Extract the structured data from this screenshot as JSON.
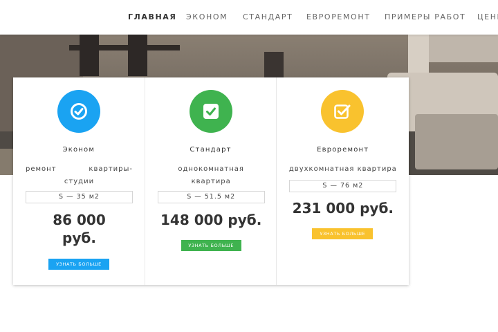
{
  "nav": {
    "items": [
      {
        "label": "ГЛАВНАЯ",
        "active": true
      },
      {
        "label": "ЭКОНОМ",
        "active": false
      },
      {
        "label": "СТАНДАРТ",
        "active": false
      },
      {
        "label": "ЕВРОРЕМОНТ",
        "active": false
      },
      {
        "label": "ПРИМЕРЫ РАБОТ",
        "active": false
      },
      {
        "label": "ЦЕНЫ",
        "active": false
      }
    ]
  },
  "cards": [
    {
      "title": "Эконом",
      "description": "ремонт квартиры-студии",
      "area": "S — 35 м2",
      "price": "86 000 руб.",
      "button": "УЗНАТЬ БОЛЬШЕ",
      "icon": "check-circle-icon",
      "color": "#1aa3f2",
      "button_color": "#1aa3f2"
    },
    {
      "title": "Стандарт",
      "description": "однокомнатная квартира",
      "area": "S — 51.5 м2",
      "price": "148 000 руб.",
      "button": "УЗНАТЬ БОЛЬШЕ",
      "icon": "check-square-icon",
      "color": "#3fb34f",
      "button_color": "#3fb34f"
    },
    {
      "title": "Евроремонт",
      "description": "двухкомнатная квартира",
      "area": "S — 76 м2",
      "price": "231 000 руб.",
      "button": "УЗНАТЬ БОЛЬШЕ",
      "icon": "checkbox-edit-icon",
      "color": "#f9c22e",
      "button_color": "#f9c22e"
    }
  ]
}
